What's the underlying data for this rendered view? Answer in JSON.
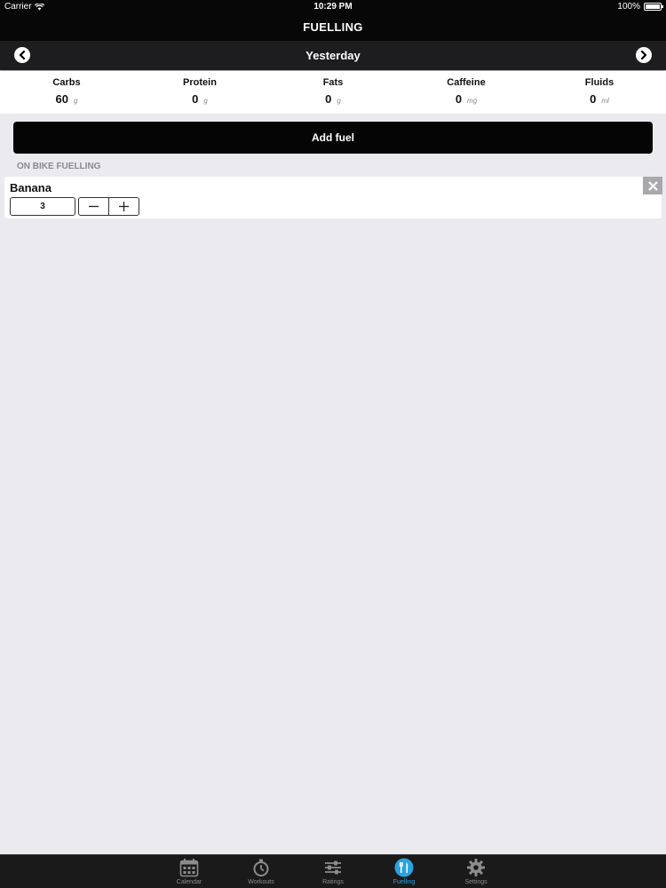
{
  "status_bar": {
    "carrier": "Carrier",
    "time": "10:29 PM",
    "battery": "100%"
  },
  "header": {
    "title": "FUELLING"
  },
  "date_nav": {
    "label": "Yesterday",
    "prev_icon": "chevron-left-icon",
    "next_icon": "chevron-right-icon"
  },
  "summary": {
    "metrics": [
      {
        "name": "Carbs",
        "value": "60",
        "unit": "g"
      },
      {
        "name": "Protein",
        "value": "0",
        "unit": "g"
      },
      {
        "name": "Fats",
        "value": "0",
        "unit": "g"
      },
      {
        "name": "Caffeine",
        "value": "0",
        "unit": "mg"
      },
      {
        "name": "Fluids",
        "value": "0",
        "unit": "ml"
      }
    ]
  },
  "actions": {
    "add_fuel_label": "Add fuel"
  },
  "section": {
    "title": "ON BIKE FUELLING",
    "items": [
      {
        "name": "Banana",
        "quantity": "3"
      }
    ]
  },
  "tab_bar": {
    "active_color": "#2aa3e0",
    "tabs": [
      {
        "label": "Calendar",
        "icon": "calendar-icon",
        "active": false
      },
      {
        "label": "Workouts",
        "icon": "stopwatch-icon",
        "active": false
      },
      {
        "label": "Ratings",
        "icon": "sliders-icon",
        "active": false
      },
      {
        "label": "Fuelling",
        "icon": "fork-knife-icon",
        "active": true
      },
      {
        "label": "Settings",
        "icon": "gear-icon",
        "active": false
      }
    ]
  }
}
